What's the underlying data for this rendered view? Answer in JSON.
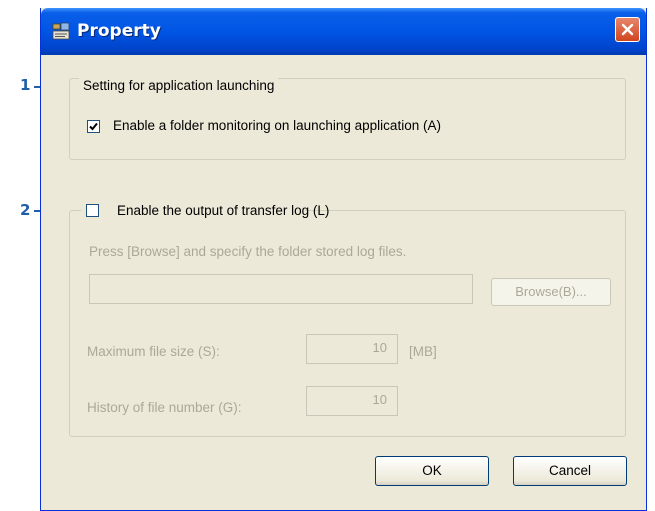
{
  "callouts": [
    "1",
    "2"
  ],
  "window": {
    "title": "Property",
    "close_icon": "close-icon"
  },
  "launch_group": {
    "legend": "Setting for application launching",
    "folder_monitoring": {
      "label": "Enable a folder monitoring on launching application (A)",
      "checked": true
    }
  },
  "log_group": {
    "enable_output": {
      "label": "Enable the output of transfer log (L)",
      "checked": false
    },
    "instruction": "Press [Browse] and specify the folder stored log files.",
    "folder_path": {
      "value": ""
    },
    "browse_label": "Browse(B)...",
    "max_size_label": "Maximum file size (S):",
    "max_size_value": "10",
    "max_size_unit": "[MB]",
    "history_label": "History of file number (G):",
    "history_value": "10"
  },
  "buttons": {
    "ok": "OK",
    "cancel": "Cancel"
  },
  "colors": {
    "callout": "#1f5fa8",
    "titlebar": "#0055e5",
    "dialog_bg": "#ece9d8"
  }
}
